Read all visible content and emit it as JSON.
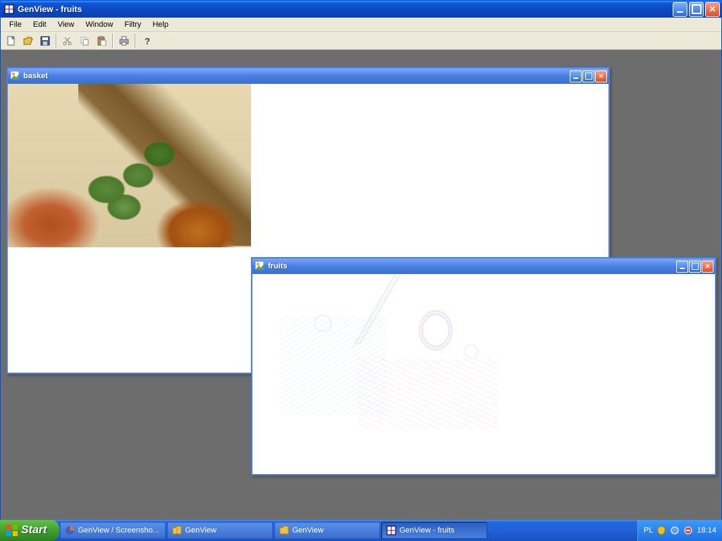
{
  "app": {
    "title": "GenView - fruits"
  },
  "menus": [
    "File",
    "Edit",
    "View",
    "Window",
    "Filtry",
    "Help"
  ],
  "tools": [
    "new",
    "open",
    "save",
    "|",
    "cut",
    "copy",
    "paste",
    "|",
    "print",
    "|",
    "help"
  ],
  "child_windows": {
    "basket": {
      "title": "basket"
    },
    "fruits": {
      "title": "fruits"
    }
  },
  "taskbar": {
    "start": "Start",
    "buttons": [
      {
        "label": "GenView / Screensho...",
        "icon": "firefox"
      },
      {
        "label": "GenView",
        "icon": "folder-zip"
      },
      {
        "label": "GenView",
        "icon": "folder"
      },
      {
        "label": "GenView - fruits",
        "icon": "app",
        "active": true
      }
    ],
    "lang": "PL",
    "clock": "18:14",
    "tray": [
      "shield",
      "volume",
      "net"
    ]
  }
}
